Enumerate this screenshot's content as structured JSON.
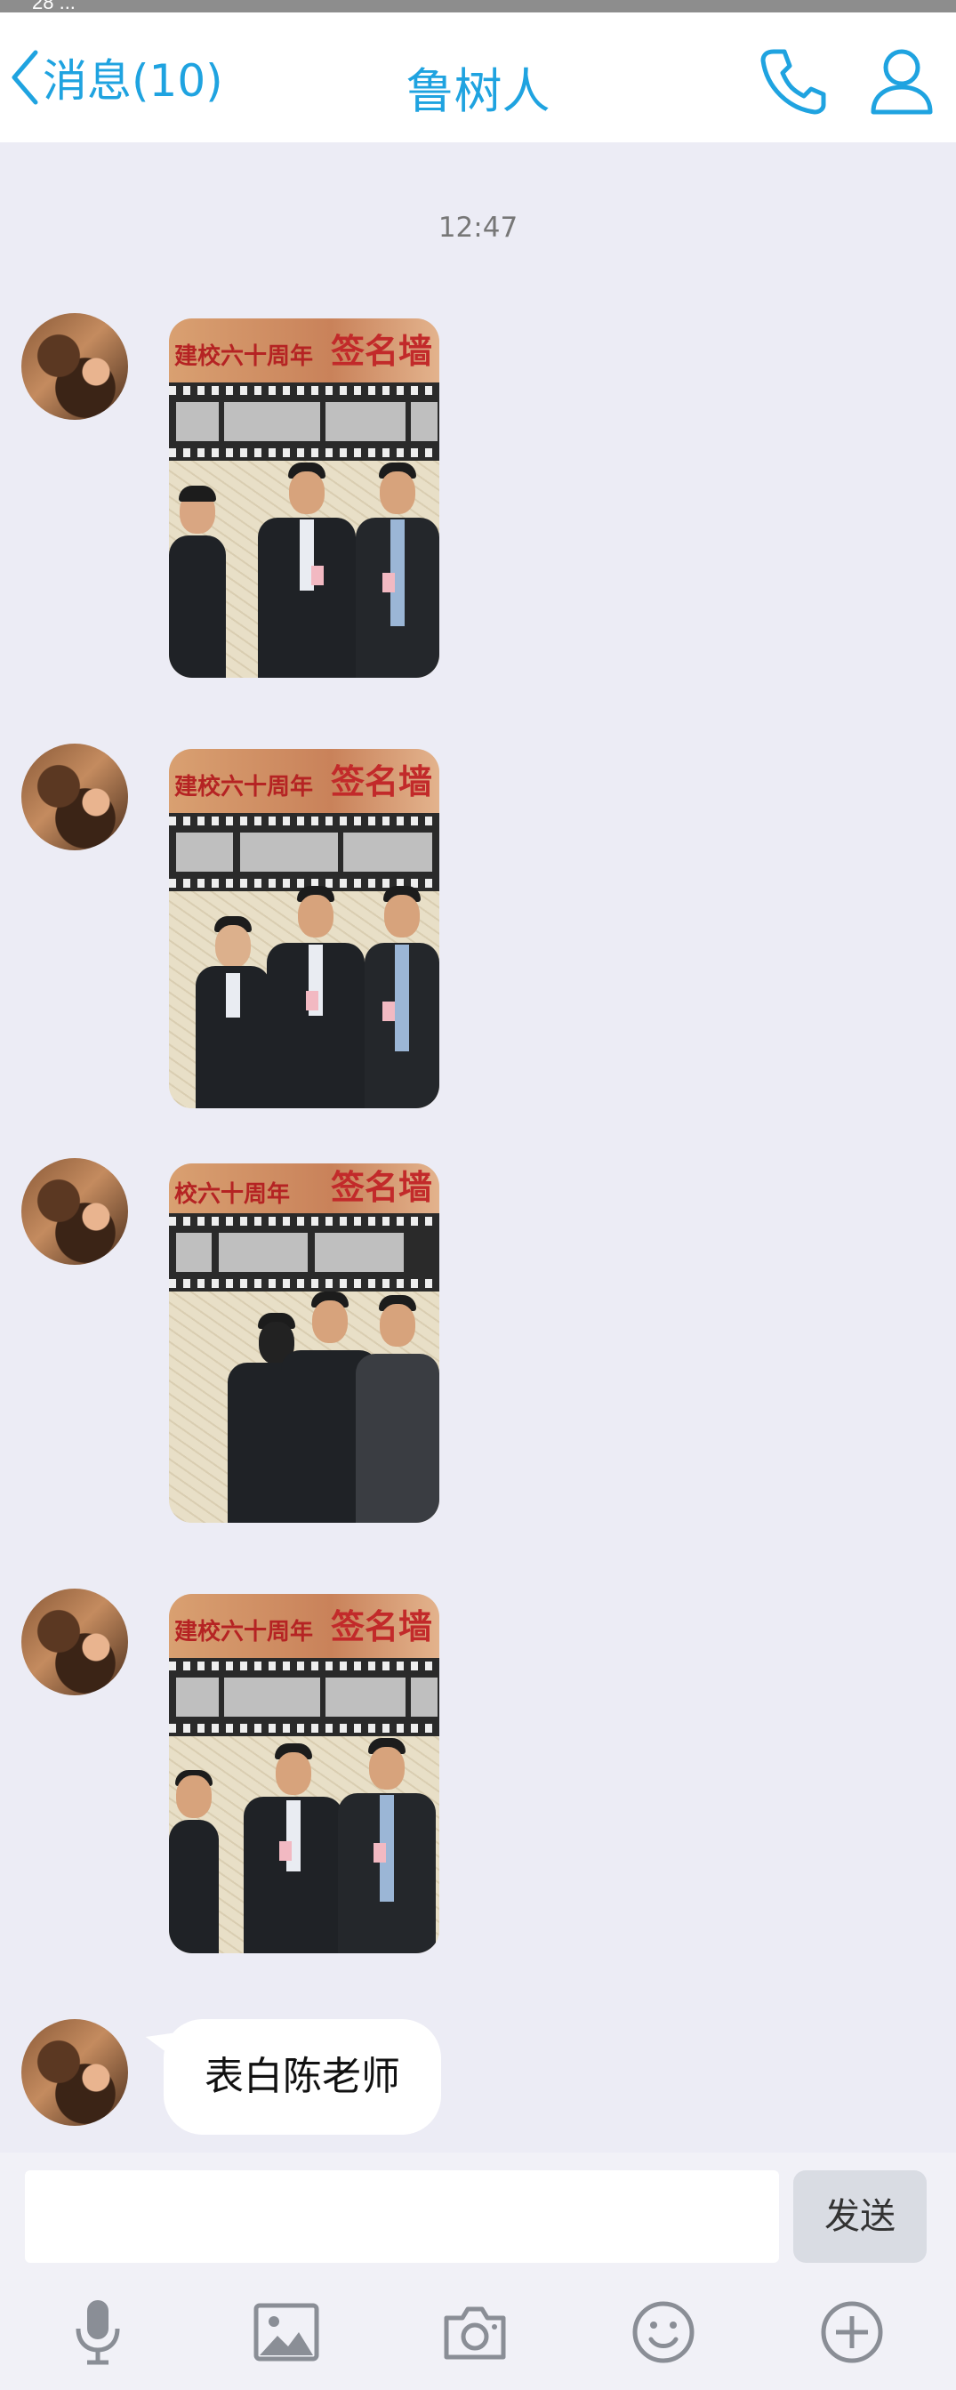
{
  "status_bar": {
    "text": "28 ..."
  },
  "nav": {
    "back_label": "消息(10)",
    "title": "鲁树人",
    "phone_icon": "phone-icon",
    "profile_icon": "person-icon",
    "accent_color": "#1fa3e0"
  },
  "chat": {
    "timestamp": "12:47",
    "image_messages": [
      {
        "banner_left": "建校六十周年",
        "banner_right": "签名墙"
      },
      {
        "banner_left": "建校六十周年",
        "banner_right": "签名墙"
      },
      {
        "banner_left": "校六十周年",
        "banner_right": "签名墙"
      },
      {
        "banner_left": "建校六十周年",
        "banner_right": "签名墙"
      }
    ],
    "text_message": "表白陈老师"
  },
  "composer": {
    "input_value": "",
    "send_label": "发送"
  },
  "toolbar": {
    "icons": [
      "microphone-icon",
      "image-icon",
      "camera-icon",
      "emoji-icon",
      "plus-icon"
    ]
  }
}
